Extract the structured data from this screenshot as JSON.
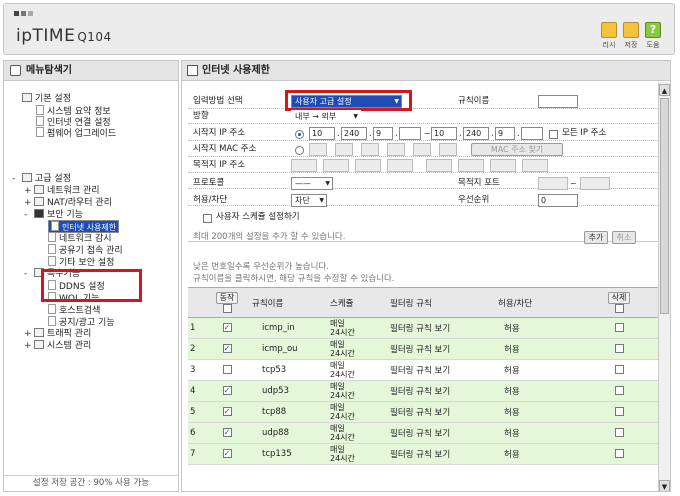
{
  "header": {
    "logo_main": "ipTIME",
    "logo_model": "Q104",
    "buttons": [
      {
        "label": "리시",
        "icon": "refresh-icon"
      },
      {
        "label": "저장",
        "icon": "save-icon"
      },
      {
        "label": "도움",
        "icon": "help-icon",
        "glyph": "?"
      }
    ]
  },
  "left_panel": {
    "title": "메뉴탐색기",
    "basic_settings": "기본 설정",
    "basic_items": [
      "시스템 요약 정보",
      "인터넷 연결 설정",
      "펌웨어 업그레이드"
    ],
    "advanced_settings": "고급 설정",
    "network_mgmt": "네트워크 관리",
    "nat_router": "NAT/라우터 관리",
    "security": "보안 기능",
    "security_items": [
      "인터넷 사용제한",
      "네트워크 감시",
      "공유기 접속 관리",
      "기타 보안 설정"
    ],
    "special": "특수기능",
    "special_items": [
      "DDNS 설정",
      "WOL 기능",
      "호스트검색",
      "공지/광고 기능"
    ],
    "traffic": "트래픽 관리",
    "system": "시스템 관리",
    "footer": "설정 저장 공간 : 90% 사용 가능"
  },
  "right_panel": {
    "title": "인터넷 사용제한",
    "form": {
      "input_method_label": "입력방법 선택",
      "input_method_value": "사용자 고급 설정",
      "rule_name_label": "규칙이름",
      "direction_label": "방향",
      "direction_value": "내부 → 외부",
      "src_ip_label": "시작지 IP 주소",
      "src_ip_from": [
        "10",
        "240",
        "9",
        ""
      ],
      "src_ip_to": [
        "10",
        "240",
        "9",
        ""
      ],
      "all_ip_label": "모든 IP 주소",
      "src_mac_label": "시작지 MAC 주소",
      "mac_find_button": "MAC 주소 찾기",
      "dst_ip_label": "목적지 IP 주소",
      "protocol_label": "프로토콜",
      "protocol_value": "——",
      "dst_port_label": "목적지 포트",
      "port_sep": "~",
      "allow_label": "허용/차단",
      "allow_value": "차단",
      "priority_label": "우선순위",
      "priority_value": "0",
      "schedule_label": "사용자 스케쥴 설정하기",
      "max_note": "최대 200개의 설정을 추가 할 수 있습니다.",
      "add_button": "추가",
      "cancel_button": "취소"
    },
    "notes": [
      "낮은 번호일수록 우선순위가 높습니다.",
      "규칙이름을 클릭하시면, 해당 규칙을 수정할 수 있습니다."
    ],
    "table": {
      "headers": {
        "action": "동작",
        "rule_name": "규칙이름",
        "schedule": "스케쥴",
        "filter_rule": "필터링 규칙",
        "allow_block": "허용/차단",
        "delete": "삭제"
      },
      "rows": [
        {
          "num": "1",
          "checked": true,
          "name": "icmp_in",
          "sched1": "매일",
          "sched2": "24시간",
          "filter": "필터링 규칙 보기",
          "allow": "허용",
          "green": true
        },
        {
          "num": "2",
          "checked": true,
          "name": "icmp_ou",
          "sched1": "매일",
          "sched2": "24시간",
          "filter": "필터링 규칙 보기",
          "allow": "허용",
          "green": true
        },
        {
          "num": "3",
          "checked": false,
          "name": "tcp53",
          "sched1": "매일",
          "sched2": "24시간",
          "filter": "필터링 규칙 보기",
          "allow": "허용",
          "green": false
        },
        {
          "num": "4",
          "checked": true,
          "name": "udp53",
          "sched1": "매일",
          "sched2": "24시간",
          "filter": "필터링 규칙 보기",
          "allow": "허용",
          "green": true
        },
        {
          "num": "5",
          "checked": true,
          "name": "tcp88",
          "sched1": "매일",
          "sched2": "24시간",
          "filter": "필터링 규칙 보기",
          "allow": "허용",
          "green": true
        },
        {
          "num": "6",
          "checked": true,
          "name": "udp88",
          "sched1": "매일",
          "sched2": "24시간",
          "filter": "필터링 규칙 보기",
          "allow": "허용",
          "green": true
        },
        {
          "num": "7",
          "checked": true,
          "name": "tcp135",
          "sched1": "매일",
          "sched2": "24시간",
          "filter": "필터링 규칙 보기",
          "allow": "허용",
          "green": true
        }
      ]
    }
  },
  "colors": {
    "highlight_red": "#d1171f",
    "selection_blue": "#1f4db5",
    "row_green": "#e4f7d8"
  }
}
